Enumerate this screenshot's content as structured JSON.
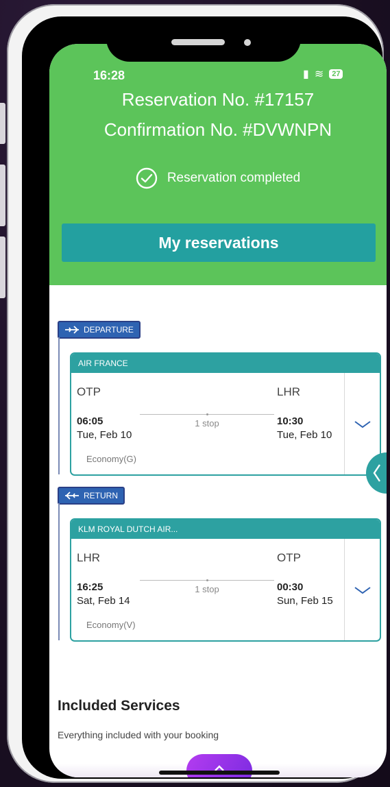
{
  "status_bar": {
    "time": "16:28",
    "battery": "27"
  },
  "header": {
    "reservation_no": "Reservation No. #17157",
    "confirmation_no": "Confirmation No. #DVWNPN",
    "status_text": "Reservation completed",
    "my_reservations_label": "My reservations"
  },
  "departure": {
    "tag": "DEPARTURE",
    "airline": "AIR FRANCE",
    "from": "OTP",
    "to": "LHR",
    "dep_time": "06:05",
    "dep_date": "Tue, Feb 10",
    "arr_time": "10:30",
    "arr_date": "Tue, Feb 10",
    "stops": "1 stop",
    "cabin": "Economy(G)"
  },
  "return": {
    "tag": "RETURN",
    "airline": "KLM ROYAL DUTCH AIR...",
    "from": "LHR",
    "to": "OTP",
    "dep_time": "16:25",
    "dep_date": "Sat, Feb 14",
    "arr_time": "00:30",
    "arr_date": "Sun, Feb 15",
    "stops": "1 stop",
    "cabin": "Economy(V)"
  },
  "included": {
    "title": "Included Services",
    "subtitle": "Everything included with your booking"
  },
  "colors": {
    "header_green": "#5cc45a",
    "teal": "#2da1a1",
    "tag_blue": "#2e63b2"
  }
}
